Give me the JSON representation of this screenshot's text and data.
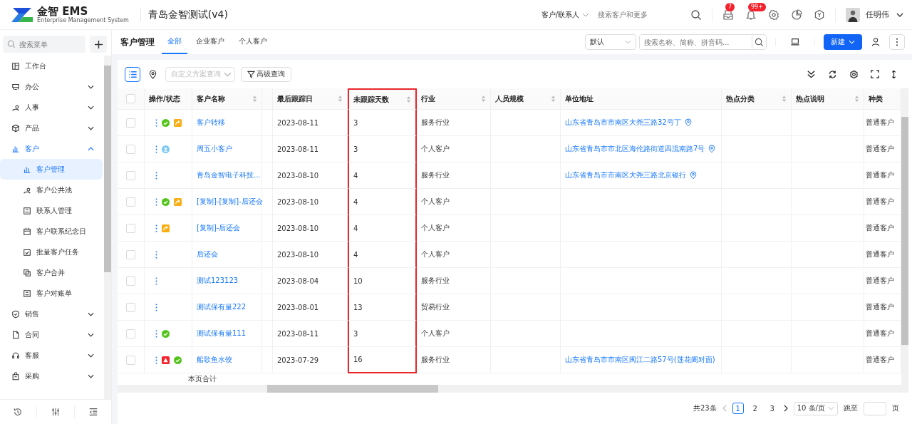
{
  "header": {
    "brand": "金智 EMS",
    "brand_sub": "Enterprise Management System",
    "app_title": "青岛金智测试(v4)",
    "scope": "客户/联系人",
    "search_placeholder": "搜索客户和更多",
    "badges": [
      {
        "kind": "mail",
        "count": "7"
      },
      {
        "kind": "bell",
        "count": "99+"
      },
      {
        "kind": "gear"
      },
      {
        "kind": "pie"
      },
      {
        "kind": "hex"
      }
    ],
    "user": "任明伟"
  },
  "sidebar": {
    "search_placeholder": "搜索菜单",
    "items": [
      {
        "label": "工作台",
        "kind": "link"
      },
      {
        "label": "办公",
        "kind": "group",
        "expanded": false
      },
      {
        "label": "人事",
        "kind": "group",
        "expanded": false
      },
      {
        "label": "产品",
        "kind": "group",
        "expanded": false
      },
      {
        "label": "客户",
        "kind": "group",
        "expanded": true,
        "children": [
          {
            "label": "客户管理",
            "selected": true
          },
          {
            "label": "客户公共池",
            "selected": false
          },
          {
            "label": "联系人管理",
            "selected": false
          },
          {
            "label": "客户联系纪念日",
            "selected": false
          },
          {
            "label": "批量客户任务",
            "selected": false
          },
          {
            "label": "客户合并",
            "selected": false
          },
          {
            "label": "客户对账单",
            "selected": false
          }
        ]
      },
      {
        "label": "销售",
        "kind": "group",
        "expanded": false
      },
      {
        "label": "合同",
        "kind": "group",
        "expanded": false
      },
      {
        "label": "客服",
        "kind": "group",
        "expanded": false
      },
      {
        "label": "采购",
        "kind": "group",
        "expanded": false
      }
    ]
  },
  "page": {
    "title": "客户管理",
    "tabs": [
      {
        "label": "全部",
        "selected": true
      },
      {
        "label": "企业客户",
        "selected": false
      },
      {
        "label": "个人客户",
        "selected": false
      }
    ],
    "view_select": "默认",
    "search_placeholder": "搜索名称、简称、拼音码...",
    "new_button": "新建"
  },
  "toolbar": {
    "list_view_selected": true,
    "scheme_placeholder": "自定义方案查询",
    "advanced_button": "高级查询"
  },
  "table": {
    "all_checked": false,
    "columns": [
      {
        "label": "操作/状态",
        "sortable": false,
        "highlighted": false
      },
      {
        "label": "客户名称",
        "sortable": true,
        "highlighted": false
      },
      {
        "label": "最后跟踪日",
        "sortable": true,
        "highlighted": false
      },
      {
        "label": "未跟踪天数",
        "sortable": true,
        "highlighted": true
      },
      {
        "label": "行业",
        "sortable": true,
        "highlighted": false
      },
      {
        "label": "人员规模",
        "sortable": true,
        "highlighted": false
      },
      {
        "label": "单位地址",
        "sortable": false,
        "highlighted": false
      },
      {
        "label": "热点分类",
        "sortable": true,
        "highlighted": false
      },
      {
        "label": "热点说明",
        "sortable": true,
        "highlighted": false
      },
      {
        "label": "种类",
        "sortable": false,
        "highlighted": false
      }
    ],
    "rows": [
      {
        "checked": false,
        "status": [
          {
            "kind": "check"
          },
          {
            "kind": "share"
          }
        ],
        "name": "客户转移",
        "last": "2023-08-11",
        "days": "3",
        "industry": "服务行业",
        "address": "山东省青岛市市南区大尧三路32号丁",
        "kind": "普通客户"
      },
      {
        "checked": false,
        "status": [
          {
            "kind": "person"
          }
        ],
        "name": "周五小客户",
        "last": "2023-08-11",
        "days": "3",
        "industry": "个人客户",
        "address": "山东省青岛市市北区海伦路街道四流南路7号",
        "kind": "普通客户"
      },
      {
        "checked": false,
        "name": "青岛金智电子科技...",
        "last": "2023-08-10",
        "days": "4",
        "industry": "服务行业",
        "address": "山东省青岛市市南区大尧三路北京银行",
        "kind": "普通客户"
      },
      {
        "checked": false,
        "status": [
          {
            "kind": "check"
          },
          {
            "kind": "share"
          }
        ],
        "name": "[复制]-[复制]-后还会",
        "last": "2023-08-10",
        "days": "4",
        "industry": "个人客户",
        "kind": "普通客户"
      },
      {
        "checked": false,
        "status": [
          {
            "kind": "share"
          }
        ],
        "name": "[复制]-后还会",
        "last": "2023-08-10",
        "days": "4",
        "industry": "个人客户",
        "kind": "普通客户"
      },
      {
        "checked": false,
        "name": "后还会",
        "last": "2023-08-10",
        "days": "4",
        "industry": "个人客户",
        "kind": "普通客户"
      },
      {
        "checked": false,
        "name": "测试123123",
        "last": "2023-08-04",
        "days": "10",
        "industry": "服务行业",
        "kind": "普通客户"
      },
      {
        "checked": false,
        "name": "测试保有量222",
        "last": "2023-08-01",
        "days": "13",
        "industry": "贸易行业",
        "kind": "普通客户"
      },
      {
        "checked": false,
        "status": [
          {
            "kind": "check"
          }
        ],
        "name": "测试保有量111",
        "last": "2023-08-11",
        "days": "3",
        "industry": "个人客户",
        "kind": "普通客户"
      },
      {
        "checked": false,
        "status": [
          {
            "kind": "alert"
          },
          {
            "kind": "check"
          }
        ],
        "name": "船歌鱼水饺",
        "last": "2023-07-29",
        "days": "16",
        "industry": "服务行业",
        "address": "山东省青岛市市南区闽江二路57号(莲花阁对面)",
        "kind": "普通客户"
      }
    ],
    "summary_label": "本页合计"
  },
  "pagination": {
    "total": "共23条",
    "pages": [
      {
        "label": "1",
        "selected": true
      },
      {
        "label": "2",
        "selected": false
      },
      {
        "label": "3",
        "selected": false
      }
    ],
    "page_size": "10 条/页",
    "jump_label": "跳至",
    "page_unit": "页"
  }
}
